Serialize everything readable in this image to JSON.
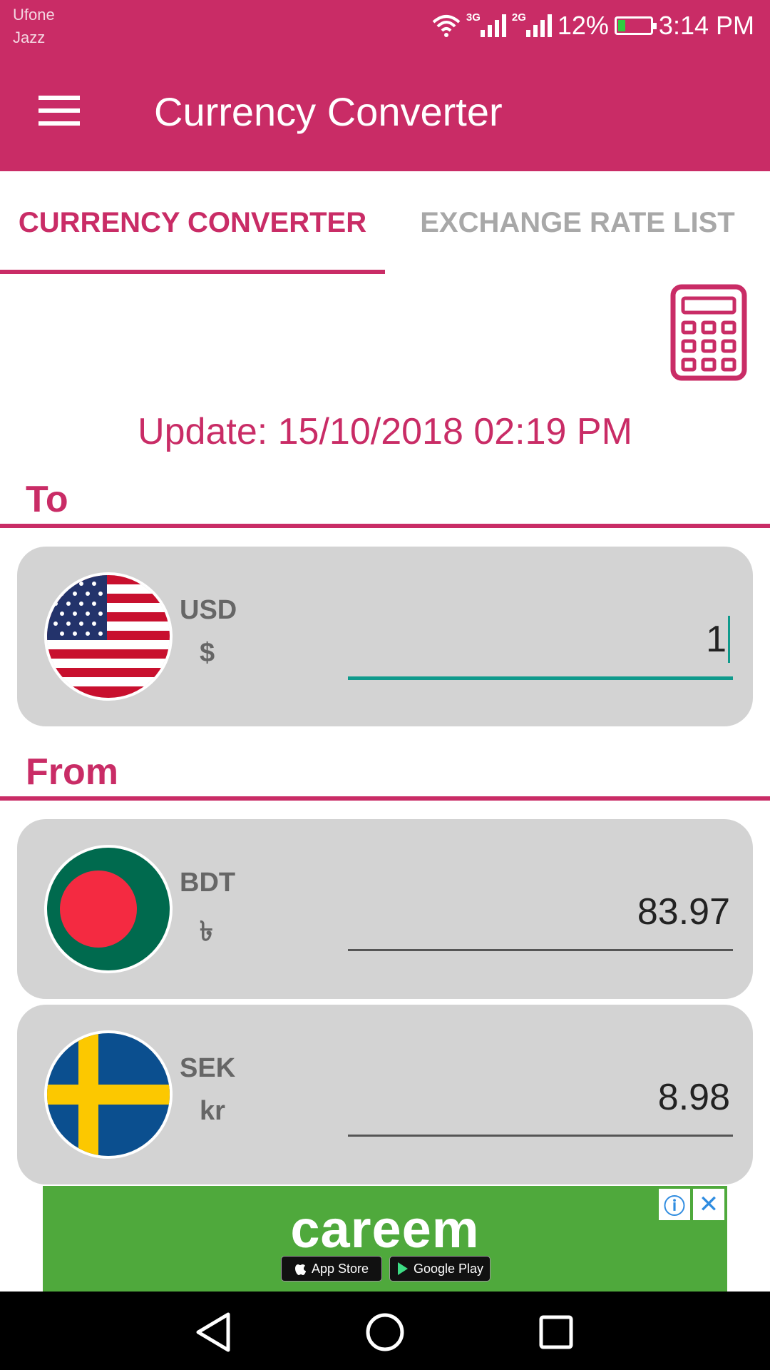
{
  "status_bar": {
    "carrier_1": "Ufone",
    "carrier_2": "Jazz",
    "network_1": "3G",
    "network_2": "2G",
    "battery": "12%",
    "time": "3:14 PM"
  },
  "app_bar": {
    "title": "Currency Converter",
    "menu_icon": "hamburger-menu-icon"
  },
  "tabs": [
    {
      "label": "CURRENCY CONVERTER",
      "active": true
    },
    {
      "label": "EXCHANGE RATE LIST",
      "active": false
    }
  ],
  "calculator_icon": "calculator-icon",
  "update_text": "Update: 15/10/2018 02:19 PM",
  "to_section": {
    "label": "To",
    "currency": {
      "code": "USD",
      "symbol": "$",
      "value": "1",
      "flag": "us-flag-icon"
    }
  },
  "from_section": {
    "label": "From",
    "currencies": [
      {
        "code": "BDT",
        "symbol": "৳",
        "value": "83.97",
        "flag": "bangladesh-flag-icon"
      },
      {
        "code": "SEK",
        "symbol": "kr",
        "value": "8.98",
        "flag": "sweden-flag-icon"
      }
    ]
  },
  "ad": {
    "brand": "careem",
    "badge_1": "App Store",
    "badge_2": "Google Play",
    "info_icon": "info-icon",
    "close_icon": "close-icon"
  },
  "colors": {
    "primary": "#c92c66",
    "tab_inactive": "#a8a8a8",
    "card_bg": "#d3d3d3",
    "input_active": "#0f9a8c",
    "ad_bg": "#4fa93c"
  }
}
